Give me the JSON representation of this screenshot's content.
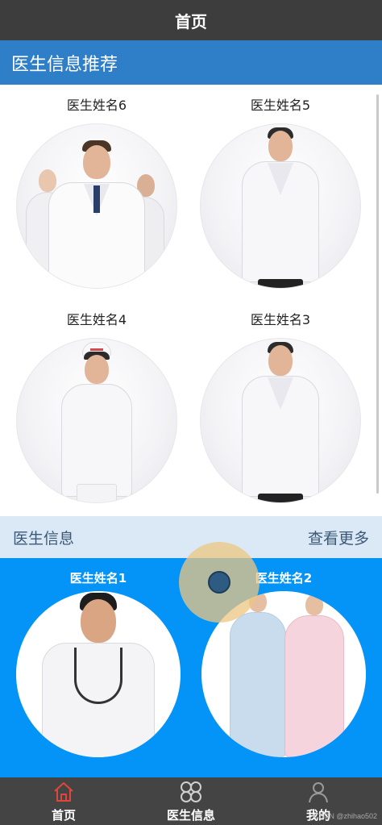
{
  "navbar": {
    "title": "首页"
  },
  "recommend": {
    "title": "医生信息推荐",
    "doctors": [
      {
        "name": "医生姓名6"
      },
      {
        "name": "医生姓名5"
      },
      {
        "name": "医生姓名4"
      },
      {
        "name": "医生姓名3"
      }
    ]
  },
  "info": {
    "title": "医生信息",
    "more_label": "查看更多",
    "doctors": [
      {
        "name": "医生姓名1"
      },
      {
        "name": "医生姓名2"
      }
    ]
  },
  "tabbar": {
    "items": [
      {
        "label": "首页",
        "icon": "home-icon"
      },
      {
        "label": "医生信息",
        "icon": "grid-icon"
      },
      {
        "label": "我的",
        "icon": "user-icon"
      }
    ]
  },
  "watermark": "CSDN @zhihao502",
  "colors": {
    "navbar": "#3d3d3d",
    "section_header": "#2f7fc8",
    "info_bar": "#dbe9f6",
    "blue_section": "#0494f8",
    "tabbar": "#444444",
    "active_tab_icon": "#e0463a"
  }
}
